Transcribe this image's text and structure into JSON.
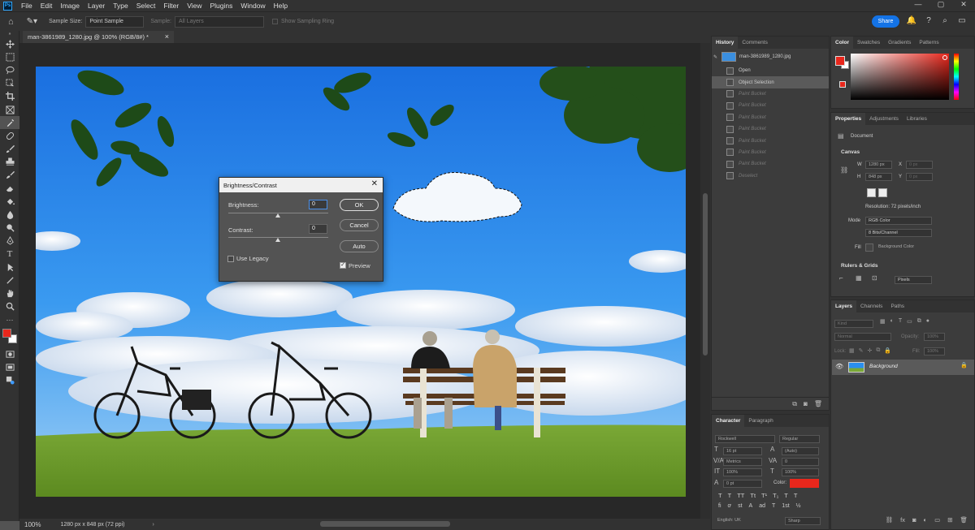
{
  "app": {
    "logo": "Ps"
  },
  "menubar": {
    "items": [
      "File",
      "Edit",
      "Image",
      "Layer",
      "Type",
      "Select",
      "Filter",
      "View",
      "Plugins",
      "Window",
      "Help"
    ]
  },
  "window_controls": {
    "minimize": "—",
    "maximize": "▢",
    "close": "✕"
  },
  "options": {
    "sample_size_label": "Sample Size:",
    "sample_size_value": "Point Sample",
    "sample_label": "Sample:",
    "sample_value": "All Layers",
    "show_ring_label": "Show Sampling Ring",
    "share_label": "Share"
  },
  "document": {
    "tab_title": "man-3861989_1280.jpg @ 100% (RGB/8#) *",
    "tab_close": "×",
    "zoom": "100%",
    "status": "1280 px x 848 px (72 ppi)"
  },
  "dialog": {
    "title": "Brightness/Contrast",
    "close": "✕",
    "brightness_label": "Brightness:",
    "brightness_value": "0",
    "contrast_label": "Contrast:",
    "contrast_value": "0",
    "ok": "OK",
    "cancel": "Cancel",
    "auto": "Auto",
    "use_legacy": "Use Legacy",
    "preview": "Preview"
  },
  "history": {
    "tabs": [
      "History",
      "Comments"
    ],
    "snapshot": "man-3861989_1280.jpg",
    "items": [
      {
        "label": "Open",
        "state": "normal"
      },
      {
        "label": "Object Selection",
        "state": "selected"
      },
      {
        "label": "Paint Bucket",
        "state": "dim"
      },
      {
        "label": "Paint Bucket",
        "state": "dim"
      },
      {
        "label": "Paint Bucket",
        "state": "dim"
      },
      {
        "label": "Paint Bucket",
        "state": "dim"
      },
      {
        "label": "Paint Bucket",
        "state": "dim"
      },
      {
        "label": "Paint Bucket",
        "state": "dim"
      },
      {
        "label": "Paint Bucket",
        "state": "dim"
      },
      {
        "label": "Deselect",
        "state": "dim"
      }
    ]
  },
  "color": {
    "tabs": [
      "Color",
      "Swatches",
      "Gradients",
      "Patterns"
    ],
    "foreground": "#e8271c",
    "background": "#ffffff"
  },
  "properties": {
    "tabs": [
      "Properties",
      "Adjustments",
      "Libraries"
    ],
    "doc_label": "Document",
    "canvas_label": "Canvas",
    "w_label": "W",
    "w_value": "1280 px",
    "h_label": "H",
    "h_value": "848 px",
    "x_label": "X",
    "x_value": "0 px",
    "y_label": "Y",
    "y_value": "0 px",
    "resolution": "Resolution: 72 pixels/inch",
    "mode_label": "Mode",
    "mode_value": "RGB Color",
    "bits_value": "8 Bits/Channel",
    "fill_label": "Fill",
    "fill_value": "Background Color",
    "rulers_label": "Rulers & Grids",
    "units_value": "Pixels"
  },
  "layers": {
    "tabs": [
      "Layers",
      "Channels",
      "Paths"
    ],
    "kind_value": "Kind",
    "blend_value": "Normal",
    "opacity_label": "Opacity:",
    "opacity_value": "100%",
    "lock_label": "Lock:",
    "fill_label": "Fill:",
    "fill_value": "100%",
    "layer_name": "Background"
  },
  "character": {
    "tabs": [
      "Character",
      "Paragraph"
    ],
    "font_value": "Rockwell",
    "style_value": "Regular",
    "size_value": "16 pt",
    "leading_value": "(Auto)",
    "kerning_value": "Metrics",
    "tracking_value": "0",
    "vscale_value": "100%",
    "hscale_value": "100%",
    "baseline_value": "0 pt",
    "color_label": "Color:",
    "color_value": "#e8271c",
    "language_value": "English: UK",
    "aa_value": "Sharp"
  }
}
